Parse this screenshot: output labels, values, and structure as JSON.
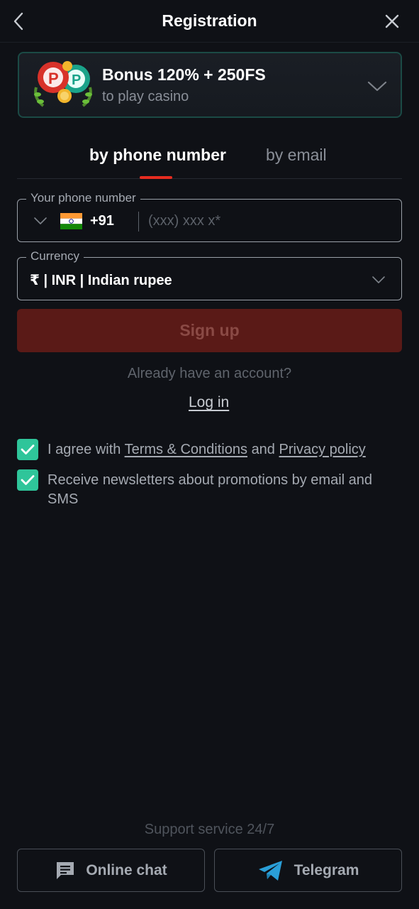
{
  "header": {
    "title": "Registration"
  },
  "bonus": {
    "title": "Bonus 120% + 250FS",
    "subtitle": "to play casino"
  },
  "tabs": [
    {
      "label": "by phone number",
      "active": true
    },
    {
      "label": "by email",
      "active": false
    }
  ],
  "phone": {
    "legend": "Your phone number",
    "country_code": "+91",
    "country_flag": "india-flag",
    "placeholder": "(xxx) xxx x*"
  },
  "currency": {
    "legend": "Currency",
    "value": "₹ | INR | Indian rupee"
  },
  "signup_label": "Sign up",
  "already_text": "Already have an account?",
  "login_label": "Log in",
  "agreements": {
    "terms_prefix": "I agree with",
    "terms_link": "Terms & Conditions",
    "terms_and": "and",
    "privacy_link": "Privacy policy",
    "newsletter": "Receive newsletters about promotions by email and SMS"
  },
  "support": {
    "title": "Support service 24/7",
    "chat_label": "Online chat",
    "telegram_label": "Telegram"
  },
  "colors": {
    "accent_red": "#e62c20",
    "signup_bg": "#5a1a17",
    "check_green": "#2fc59a",
    "background": "#0f1116",
    "telegram_blue": "#2a9fd8"
  }
}
